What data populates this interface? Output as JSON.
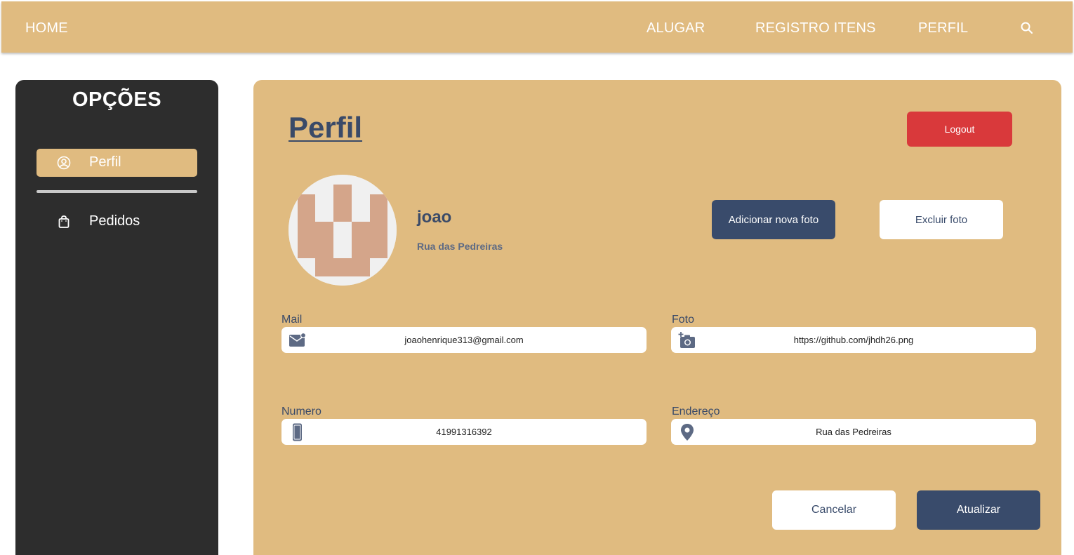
{
  "nav": {
    "home": "HOME",
    "alugar": "ALUGAR",
    "registro": "REGISTRO ITENS",
    "perfil": "PERFIL",
    "search_icon": "search-icon"
  },
  "sidebar": {
    "title": "OPÇÕES",
    "items": [
      {
        "label": "Perfil",
        "icon": "user-circle-icon",
        "active": true
      },
      {
        "label": "Pedidos",
        "icon": "shopping-bag-icon",
        "active": false
      }
    ]
  },
  "profile": {
    "page_title": "Perfil",
    "logout_label": "Logout",
    "name": "joao",
    "address": "Rua das Pedreiras",
    "add_photo_label": "Adicionar nova foto",
    "delete_photo_label": "Excluir foto"
  },
  "form": {
    "mail": {
      "label": "Mail",
      "value": "joaohenrique313@gmail.com",
      "icon": "mail-icon"
    },
    "foto": {
      "label": "Foto",
      "value": "https://github.com/jhdh26.png",
      "icon": "add-photo-icon"
    },
    "numero": {
      "label": "Numero",
      "value": "41991316392",
      "icon": "phone-icon"
    },
    "endereco": {
      "label": "Endereço",
      "value": "Rua das Pedreiras",
      "icon": "location-pin-icon"
    },
    "cancel_label": "Cancelar",
    "update_label": "Atualizar"
  },
  "colors": {
    "accent": "#e0bb80",
    "dark": "#2d2d2d",
    "navy": "#394b6b",
    "danger": "#d9393b"
  }
}
